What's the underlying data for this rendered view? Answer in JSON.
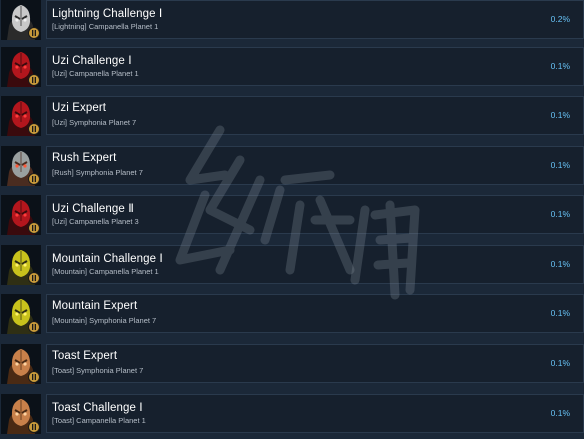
{
  "achievements": [
    {
      "name": "Lightning Challenge Ⅰ",
      "desc": "[Lightning] Campanella Planet 1",
      "pct": "0.2%",
      "skin": "#c9c9c9",
      "accent": "#2b2b2b",
      "glow": "#f0f0f0"
    },
    {
      "name": "Uzi Challenge Ⅰ",
      "desc": "[Uzi] Campanella Planet 1",
      "pct": "0.1%",
      "skin": "#b3161d",
      "accent": "#3a0a0d",
      "glow": "#ff3b3b"
    },
    {
      "name": "Uzi Expert",
      "desc": "[Uzi] Symphonia Planet 7",
      "pct": "0.1%",
      "skin": "#b3161d",
      "accent": "#3a0a0d",
      "glow": "#ff3b3b"
    },
    {
      "name": "Rush Expert",
      "desc": "[Rush] Symphonia Planet 7",
      "pct": "0.1%",
      "skin": "#9aa0a0",
      "accent": "#4a2c20",
      "glow": "#ff5a3a"
    },
    {
      "name": "Uzi Challenge Ⅱ",
      "desc": "[Uzi] Campanella Planet 3",
      "pct": "0.1%",
      "skin": "#b3161d",
      "accent": "#3a0a0d",
      "glow": "#ff3b3b"
    },
    {
      "name": "Mountain Challenge Ⅰ",
      "desc": "[Mountain] Campanella Planet 1",
      "pct": "0.1%",
      "skin": "#c8c21c",
      "accent": "#2f2f14",
      "glow": "#fff26a"
    },
    {
      "name": "Mountain Expert",
      "desc": "[Mountain] Symphonia Planet 7",
      "pct": "0.1%",
      "skin": "#c8c21c",
      "accent": "#2f2f14",
      "glow": "#fff26a"
    },
    {
      "name": "Toast Expert",
      "desc": "[Toast] Symphonia Planet 7",
      "pct": "0.1%",
      "skin": "#c8804a",
      "accent": "#4a2a14",
      "glow": "#ffd2a0"
    },
    {
      "name": "Toast Challenge Ⅰ",
      "desc": "[Toast] Campanella Planet 1",
      "pct": "0.1%",
      "skin": "#c8804a",
      "accent": "#4a2a14",
      "glow": "#ffd2a0"
    }
  ],
  "colors": {
    "background": "#1b2838",
    "panel": "#16202d",
    "panel_border": "#2a3a4d",
    "percent": "#66c0f4",
    "badge": "#c89a3a"
  }
}
